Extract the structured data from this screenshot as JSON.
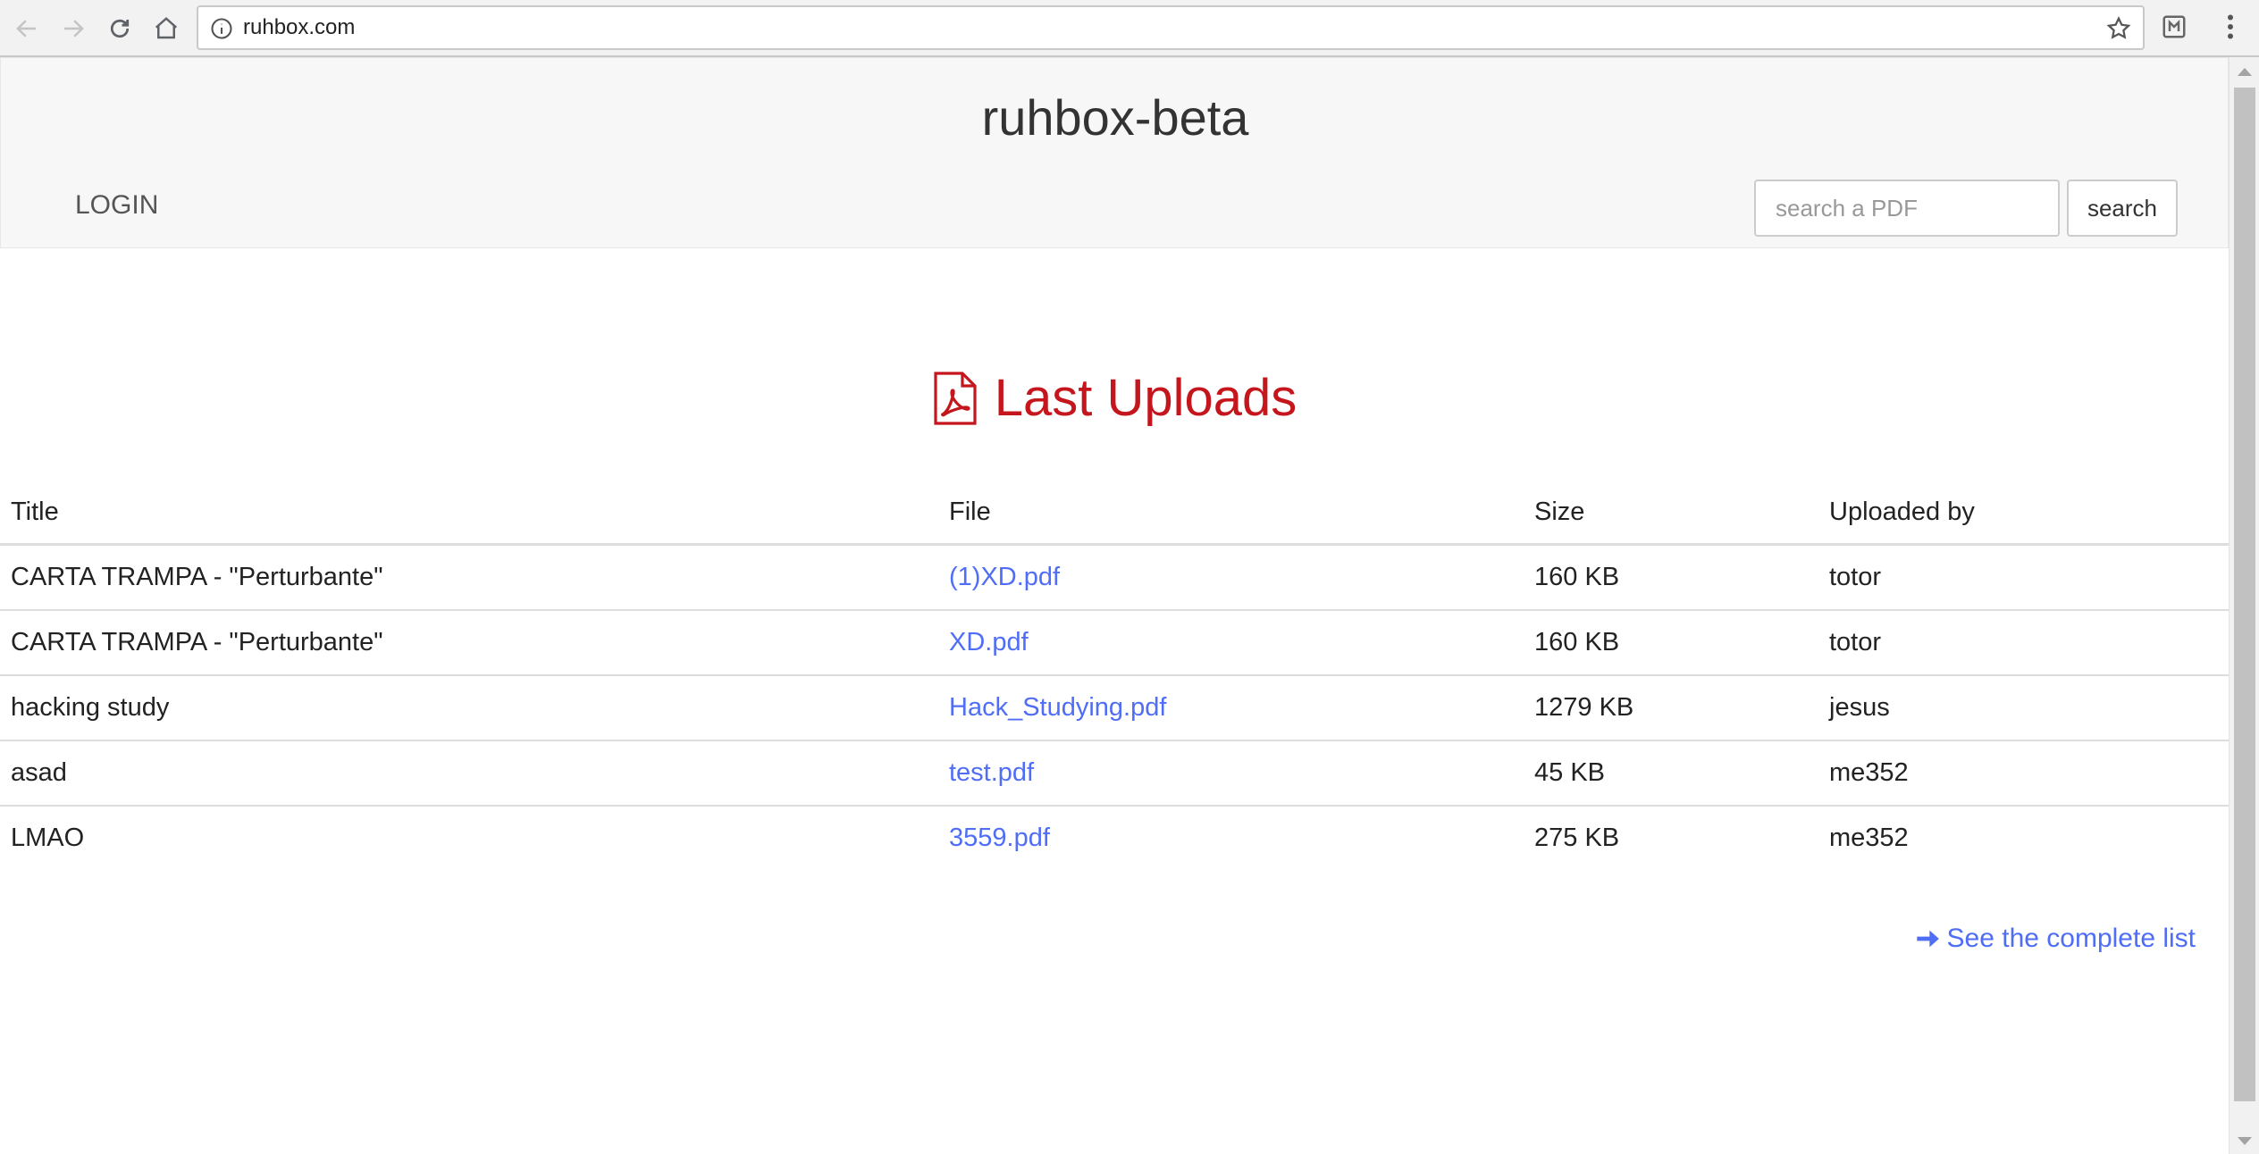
{
  "browser": {
    "url": "ruhbox.com",
    "icons": [
      "back-icon",
      "forward-icon",
      "reload-icon",
      "home-icon",
      "info-icon",
      "star-icon",
      "extension-icon",
      "menu-icon"
    ]
  },
  "header": {
    "site_title": "ruhbox-beta",
    "login_label": "LOGIN",
    "search_placeholder": "search a PDF",
    "search_button_label": "search"
  },
  "main": {
    "heading": "Last Uploads",
    "heading_color": "#c4161c",
    "link_color": "#4f6df5",
    "table": {
      "columns": [
        "Title",
        "File",
        "Size",
        "Uploaded by"
      ],
      "rows": [
        {
          "title": "CARTA TRAMPA - \"Perturbante\"",
          "file": "(1)XD.pdf",
          "size": "160 KB",
          "uploaded_by": "totor"
        },
        {
          "title": "CARTA TRAMPA - \"Perturbante\"",
          "file": "XD.pdf",
          "size": "160 KB",
          "uploaded_by": "totor"
        },
        {
          "title": "hacking study",
          "file": "Hack_Studying.pdf",
          "size": "1279 KB",
          "uploaded_by": "jesus"
        },
        {
          "title": "asad",
          "file": "test.pdf",
          "size": "45 KB",
          "uploaded_by": "me352"
        },
        {
          "title": "LMAO",
          "file": "3559.pdf",
          "size": "275 KB",
          "uploaded_by": "me352"
        }
      ]
    },
    "complete_list_label": "See the complete list"
  }
}
